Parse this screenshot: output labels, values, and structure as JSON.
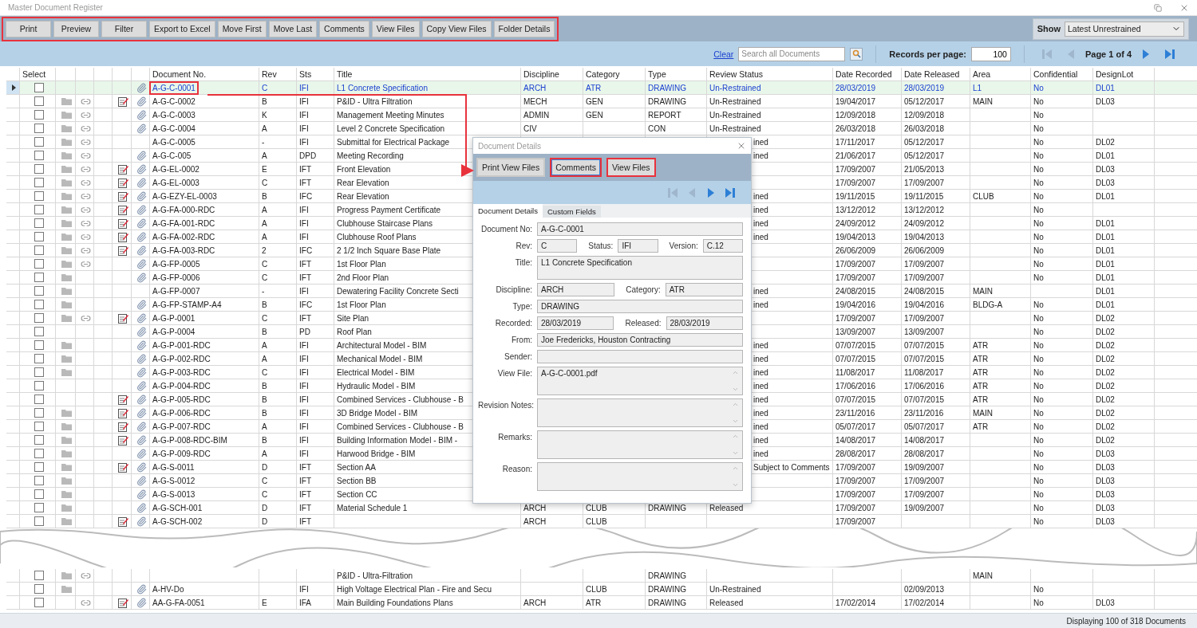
{
  "window": {
    "title": "Master Document Register"
  },
  "toolbar": {
    "highlighted": true,
    "buttons": [
      "Print",
      "Preview",
      "Filter",
      "Export to Excel",
      "Move First",
      "Move Last",
      "Comments",
      "View Files",
      "Copy View Files",
      "Folder Details"
    ],
    "show_label": "Show",
    "show_value": "Latest Unrestrained"
  },
  "search_bar": {
    "clear": "Clear",
    "placeholder": "Search all Documents",
    "records_label": "Records per page:",
    "records_value": "100",
    "page_label": "Page 1 of 4",
    "nav": [
      {
        "kind": "first",
        "disabled": true
      },
      {
        "kind": "prev",
        "disabled": true
      },
      {
        "kind": "next",
        "disabled": false
      },
      {
        "kind": "last",
        "disabled": false
      }
    ]
  },
  "table": {
    "columns": [
      "Select",
      "Document No.",
      "Rev",
      "Sts",
      "Title",
      "Discipline",
      "Category",
      "Type",
      "Review Status",
      "Date Recorded",
      "Date Released",
      "Area",
      "Confidential",
      "DesignLot"
    ],
    "rows": [
      {
        "selected": true,
        "highlighted": true,
        "checked": false,
        "folder": false,
        "link": false,
        "notes": false,
        "attach": true,
        "doc": "A-G-C-0001",
        "rev": "C",
        "sts": "IFI",
        "title": "L1 Concrete Specification",
        "discipline": "ARCH",
        "category": "ATR",
        "type": "DRAWING",
        "review": "Un-Restrained",
        "recorded": "28/03/2019",
        "released": "28/03/2019",
        "area": "L1",
        "confidential": "No",
        "lot": "DL01"
      },
      {
        "selected": false,
        "highlighted": false,
        "checked": false,
        "folder": true,
        "link": true,
        "notes": true,
        "attach": true,
        "doc": "A-G-C-0002",
        "rev": "B",
        "sts": "IFI",
        "title": "P&ID - Ultra Filtration",
        "discipline": "MECH",
        "category": "GEN",
        "type": "DRAWING",
        "review": "Un-Restrained",
        "recorded": "19/04/2017",
        "released": "05/12/2017",
        "area": "MAIN",
        "confidential": "No",
        "lot": "DL03"
      },
      {
        "selected": false,
        "highlighted": false,
        "checked": false,
        "folder": true,
        "link": true,
        "notes": false,
        "attach": true,
        "doc": "A-G-C-0003",
        "rev": "K",
        "sts": "IFI",
        "title": "Management Meeting Minutes",
        "discipline": "ADMIN",
        "category": "GEN",
        "type": "REPORT",
        "review": "Un-Restrained",
        "recorded": "12/09/2018",
        "released": "12/09/2018",
        "confidential": "No"
      },
      {
        "selected": false,
        "highlighted": false,
        "checked": false,
        "folder": true,
        "link": true,
        "notes": false,
        "attach": true,
        "doc": "A-G-C-0004",
        "rev": "A",
        "sts": "IFI",
        "title": "Level 2 Concrete Specification",
        "discipline": "CIV",
        "type": "CON",
        "review": "Un-Restrained",
        "recorded": "26/03/2018",
        "released": "26/03/2018",
        "confidential": "No"
      },
      {
        "selected": false,
        "highlighted": false,
        "checked": false,
        "folder": true,
        "link": true,
        "notes": false,
        "attach": false,
        "doc": "A-G-C-0005",
        "rev": "-",
        "sts": "IFI",
        "title": "Submittal for Electrical Package",
        "review": "ined",
        "recorded": "17/11/2017",
        "released": "05/12/2017",
        "confidential": "No",
        "lot": "DL02"
      },
      {
        "selected": false,
        "highlighted": false,
        "checked": false,
        "folder": true,
        "link": true,
        "notes": false,
        "attach": true,
        "doc": "A-G-C-005",
        "rev": "A",
        "sts": "DPD",
        "title": "Meeting Recording",
        "review": "ined",
        "recorded": "21/06/2017",
        "released": "05/12/2017",
        "confidential": "No",
        "lot": "DL01"
      },
      {
        "selected": false,
        "highlighted": false,
        "checked": false,
        "folder": true,
        "link": true,
        "notes": true,
        "attach": true,
        "doc": "A-G-EL-0002",
        "rev": "E",
        "sts": "IFT",
        "title": "Front Elevation",
        "recorded": "17/09/2007",
        "released": "21/05/2013",
        "confidential": "No",
        "lot": "DL03"
      },
      {
        "selected": false,
        "highlighted": false,
        "checked": false,
        "folder": true,
        "link": true,
        "notes": true,
        "attach": true,
        "doc": "A-G-EL-0003",
        "rev": "C",
        "sts": "IFT",
        "title": "Rear Elevation",
        "recorded": "17/09/2007",
        "released": "17/09/2007",
        "confidential": "No",
        "lot": "DL03"
      },
      {
        "selected": false,
        "highlighted": false,
        "checked": false,
        "folder": true,
        "link": true,
        "notes": true,
        "attach": true,
        "doc": "A-G-EZY-EL-0003",
        "rev": "B",
        "sts": "IFC",
        "title": "Rear Elevation",
        "review": "ined",
        "recorded": "19/11/2015",
        "released": "19/11/2015",
        "area": "CLUB",
        "confidential": "No",
        "lot": "DL01"
      },
      {
        "selected": false,
        "highlighted": false,
        "checked": false,
        "folder": true,
        "link": true,
        "notes": true,
        "attach": true,
        "doc": "A-G-FA-000-RDC",
        "rev": "A",
        "sts": "IFI",
        "title": "Progress Payment Certificate",
        "review": "ined",
        "recorded": "13/12/2012",
        "released": "13/12/2012",
        "confidential": "No"
      },
      {
        "selected": false,
        "highlighted": false,
        "checked": false,
        "folder": true,
        "link": true,
        "notes": true,
        "attach": true,
        "doc": "A-G-FA-001-RDC",
        "rev": "A",
        "sts": "IFI",
        "title": "Clubhouse Staircase Plans",
        "review": "ined",
        "recorded": "24/09/2012",
        "released": "24/09/2012",
        "confidential": "No",
        "lot": "DL01"
      },
      {
        "selected": false,
        "highlighted": false,
        "checked": false,
        "folder": true,
        "link": true,
        "notes": true,
        "attach": true,
        "doc": "A-G-FA-002-RDC",
        "rev": "A",
        "sts": "IFI",
        "title": "Clubhouse Roof Plans",
        "review": "ined",
        "recorded": "19/04/2013",
        "released": "19/04/2013",
        "confidential": "No",
        "lot": "DL01"
      },
      {
        "selected": false,
        "highlighted": false,
        "checked": false,
        "folder": true,
        "link": true,
        "notes": true,
        "attach": true,
        "doc": "A-G-FA-003-RDC",
        "rev": "2",
        "sts": "IFC",
        "title": "2 1/2 Inch Square Base Plate",
        "recorded": "26/06/2009",
        "released": "26/06/2009",
        "confidential": "No",
        "lot": "DL01"
      },
      {
        "selected": false,
        "highlighted": false,
        "checked": false,
        "folder": true,
        "link": true,
        "notes": false,
        "attach": true,
        "doc": "A-G-FP-0005",
        "rev": "C",
        "sts": "IFT",
        "title": "1st Floor Plan",
        "recorded": "17/09/2007",
        "released": "17/09/2007",
        "confidential": "No",
        "lot": "DL01"
      },
      {
        "selected": false,
        "highlighted": false,
        "checked": false,
        "folder": true,
        "link": false,
        "notes": false,
        "attach": true,
        "doc": "A-G-FP-0006",
        "rev": "C",
        "sts": "IFT",
        "title": "2nd Floor Plan",
        "recorded": "17/09/2007",
        "released": "17/09/2007",
        "confidential": "No",
        "lot": "DL01"
      },
      {
        "selected": false,
        "highlighted": false,
        "checked": false,
        "folder": true,
        "link": false,
        "notes": false,
        "attach": false,
        "doc": "A-G-FP-0007",
        "rev": "-",
        "sts": "IFI",
        "title": "Dewatering Facility Concrete Secti",
        "review": "ined",
        "recorded": "24/08/2015",
        "released": "24/08/2015",
        "area": "MAIN",
        "lot": "DL01"
      },
      {
        "selected": false,
        "highlighted": false,
        "checked": false,
        "folder": true,
        "link": false,
        "notes": false,
        "attach": true,
        "doc": "A-G-FP-STAMP-A4",
        "rev": "B",
        "sts": "IFC",
        "title": "1st Floor Plan",
        "review": "ined",
        "recorded": "19/04/2016",
        "released": "19/04/2016",
        "area": "BLDG-A",
        "confidential": "No",
        "lot": "DL01"
      },
      {
        "selected": false,
        "highlighted": false,
        "checked": false,
        "folder": true,
        "link": true,
        "notes": true,
        "attach": true,
        "doc": "A-G-P-0001",
        "rev": "C",
        "sts": "IFT",
        "title": "Site Plan",
        "recorded": "17/09/2007",
        "released": "17/09/2007",
        "confidential": "No",
        "lot": "DL02"
      },
      {
        "selected": false,
        "highlighted": false,
        "checked": false,
        "folder": false,
        "link": false,
        "notes": false,
        "attach": true,
        "doc": "A-G-P-0004",
        "rev": "B",
        "sts": "PD",
        "title": "Roof Plan",
        "recorded": "13/09/2007",
        "released": "13/09/2007",
        "confidential": "No",
        "lot": "DL02"
      },
      {
        "selected": false,
        "highlighted": false,
        "checked": false,
        "folder": true,
        "link": false,
        "notes": false,
        "attach": true,
        "doc": "A-G-P-001-RDC",
        "rev": "A",
        "sts": "IFI",
        "title": "Architectural Model - BIM",
        "review": "ined",
        "recorded": "07/07/2015",
        "released": "07/07/2015",
        "area": "ATR",
        "confidential": "No",
        "lot": "DL02"
      },
      {
        "selected": false,
        "highlighted": false,
        "checked": false,
        "folder": true,
        "link": false,
        "notes": false,
        "attach": true,
        "doc": "A-G-P-002-RDC",
        "rev": "A",
        "sts": "IFI",
        "title": "Mechanical Model - BIM",
        "review": "ined",
        "recorded": "07/07/2015",
        "released": "07/07/2015",
        "area": "ATR",
        "confidential": "No",
        "lot": "DL02"
      },
      {
        "selected": false,
        "highlighted": false,
        "checked": false,
        "folder": true,
        "link": false,
        "notes": false,
        "attach": true,
        "doc": "A-G-P-003-RDC",
        "rev": "C",
        "sts": "IFI",
        "title": "Electrical Model - BIM",
        "review": "ined",
        "recorded": "11/08/2017",
        "released": "11/08/2017",
        "area": "ATR",
        "confidential": "No",
        "lot": "DL02"
      },
      {
        "selected": false,
        "highlighted": false,
        "checked": false,
        "folder": false,
        "link": false,
        "notes": false,
        "attach": true,
        "doc": "A-G-P-004-RDC",
        "rev": "B",
        "sts": "IFI",
        "title": "Hydraulic Model - BIM",
        "review": "ined",
        "recorded": "17/06/2016",
        "released": "17/06/2016",
        "area": "ATR",
        "confidential": "No",
        "lot": "DL02"
      },
      {
        "selected": false,
        "highlighted": false,
        "checked": false,
        "folder": false,
        "link": false,
        "notes": true,
        "attach": true,
        "doc": "A-G-P-005-RDC",
        "rev": "B",
        "sts": "IFI",
        "title": "Combined Services - Clubhouse - B",
        "review": "ined",
        "recorded": "07/07/2015",
        "released": "07/07/2015",
        "area": "ATR",
        "confidential": "No",
        "lot": "DL02"
      },
      {
        "selected": false,
        "highlighted": false,
        "checked": false,
        "folder": true,
        "link": false,
        "notes": true,
        "attach": true,
        "doc": "A-G-P-006-RDC",
        "rev": "B",
        "sts": "IFI",
        "title": "3D Bridge Model - BIM",
        "review": "ined",
        "recorded": "23/11/2016",
        "released": "23/11/2016",
        "area": "MAIN",
        "confidential": "No",
        "lot": "DL02"
      },
      {
        "selected": false,
        "highlighted": false,
        "checked": false,
        "folder": true,
        "link": false,
        "notes": true,
        "attach": true,
        "doc": "A-G-P-007-RDC",
        "rev": "A",
        "sts": "IFI",
        "title": "Combined Services - Clubhouse - B",
        "review": "ined",
        "recorded": "05/07/2017",
        "released": "05/07/2017",
        "area": "ATR",
        "confidential": "No",
        "lot": "DL02"
      },
      {
        "selected": false,
        "highlighted": false,
        "checked": false,
        "folder": true,
        "link": false,
        "notes": true,
        "attach": true,
        "doc": "A-G-P-008-RDC-BIM",
        "rev": "B",
        "sts": "IFI",
        "title": "Building Information Model - BIM -",
        "review": "ined",
        "recorded": "14/08/2017",
        "released": "14/08/2017",
        "confidential": "No",
        "lot": "DL02"
      },
      {
        "selected": false,
        "highlighted": false,
        "checked": false,
        "folder": true,
        "link": false,
        "notes": false,
        "attach": true,
        "doc": "A-G-P-009-RDC",
        "rev": "A",
        "sts": "IFI",
        "title": "Harwood Bridge - BIM",
        "review": "ined",
        "recorded": "28/08/2017",
        "released": "28/08/2017",
        "confidential": "No",
        "lot": "DL03"
      },
      {
        "selected": false,
        "highlighted": false,
        "checked": false,
        "folder": true,
        "link": false,
        "notes": true,
        "attach": true,
        "doc": "A-G-S-0011",
        "rev": "D",
        "sts": "IFT",
        "title": "Section AA",
        "review": "Subject to Comments",
        "recorded": "17/09/2007",
        "released": "19/09/2007",
        "confidential": "No",
        "lot": "DL03"
      },
      {
        "selected": false,
        "highlighted": false,
        "checked": false,
        "folder": true,
        "link": false,
        "notes": false,
        "attach": true,
        "doc": "A-G-S-0012",
        "rev": "C",
        "sts": "IFT",
        "title": "Section BB",
        "recorded": "17/09/2007",
        "released": "17/09/2007",
        "confidential": "No",
        "lot": "DL03"
      },
      {
        "selected": false,
        "highlighted": false,
        "checked": false,
        "folder": true,
        "link": false,
        "notes": false,
        "attach": true,
        "doc": "A-G-S-0013",
        "rev": "C",
        "sts": "IFT",
        "title": "Section CC",
        "recorded": "17/09/2007",
        "released": "17/09/2007",
        "confidential": "No",
        "lot": "DL03"
      },
      {
        "selected": false,
        "highlighted": false,
        "checked": false,
        "folder": true,
        "link": false,
        "notes": false,
        "attach": true,
        "doc": "A-G-SCH-001",
        "rev": "D",
        "sts": "IFT",
        "title": "Material Schedule 1",
        "discipline": "ARCH",
        "category": "CLUB",
        "type": "DRAWING",
        "review": "Released",
        "recorded": "17/09/2007",
        "released": "19/09/2007",
        "confidential": "No",
        "lot": "DL03"
      },
      {
        "selected": false,
        "highlighted": false,
        "checked": false,
        "folder": true,
        "link": false,
        "notes": true,
        "attach": true,
        "doc": "A-G-SCH-002",
        "rev": "D",
        "sts": "IFT",
        "discipline": "ARCH",
        "category": "CLUB",
        "recorded": "17/09/2007",
        "confidential": "No",
        "lot": "DL03"
      }
    ],
    "rows_after_break": [
      {
        "selected": false,
        "checked": false,
        "folder": true,
        "link": true,
        "notes": false,
        "attach": false,
        "title": "P&ID - Ultra-Filtration",
        "type": "DRAWING",
        "area": "MAIN"
      },
      {
        "selected": false,
        "checked": false,
        "folder": true,
        "link": false,
        "notes": false,
        "attach": true,
        "doc": "A-HV-Do",
        "sts": "IFI",
        "title": "High Voltage Electrical Plan - Fire and Secu",
        "category": "CLUB",
        "type": "DRAWING",
        "review": "Un-Restrained",
        "released": "02/09/2013",
        "confidential": "No"
      },
      {
        "selected": false,
        "checked": false,
        "folder": false,
        "link": true,
        "notes": true,
        "attach": true,
        "doc": "AA-G-FA-0051",
        "rev": "E",
        "sts": "IFA",
        "title": "Main Building Foundations Plans",
        "discipline": "ARCH",
        "category": "ATR",
        "type": "DRAWING",
        "review": "Released",
        "recorded": "17/02/2014",
        "released": "17/02/2014",
        "confidential": "No",
        "lot": "DL03"
      }
    ]
  },
  "dialog": {
    "title": "Document Details",
    "buttons": [
      {
        "label": "Print View Files",
        "highlighted": false,
        "focused": false
      },
      {
        "label": "Comments",
        "highlighted": true,
        "focused": true
      },
      {
        "label": "View Files",
        "highlighted": true,
        "focused": false
      }
    ],
    "nav": [
      {
        "kind": "first",
        "disabled": true
      },
      {
        "kind": "prev",
        "disabled": true
      },
      {
        "kind": "next",
        "disabled": false
      },
      {
        "kind": "last",
        "disabled": false
      }
    ],
    "tabs": [
      {
        "label": "Document Details",
        "selected": true
      },
      {
        "label": "Custom Fields",
        "selected": false
      }
    ],
    "rows": [
      {
        "kind": "line",
        "fields": [
          {
            "label": "Document No:",
            "value": "A-G-C-0001"
          }
        ]
      },
      {
        "kind": "line",
        "fields": [
          {
            "label": "Rev:",
            "value": "C"
          },
          {
            "label": "Status:",
            "value": "IFI"
          },
          {
            "label": "Version:",
            "value": "C.12"
          }
        ]
      },
      {
        "kind": "box",
        "fields": [
          {
            "label": "Title:",
            "value": "L1 Concrete Specification"
          }
        ]
      },
      {
        "kind": "line",
        "fields": [
          {
            "label": "Discipline:",
            "value": "ARCH"
          },
          {
            "label": "Category:",
            "value": "ATR"
          }
        ]
      },
      {
        "kind": "line",
        "fields": [
          {
            "label": "Type:",
            "value": "DRAWING"
          }
        ]
      },
      {
        "kind": "line",
        "fields": [
          {
            "label": "Recorded:",
            "value": "28/03/2019"
          },
          {
            "label": "Released:",
            "value": "28/03/2019"
          }
        ]
      },
      {
        "kind": "line",
        "fields": [
          {
            "label": "From:",
            "value": "Joe Fredericks, Houston Contracting"
          }
        ]
      },
      {
        "kind": "line",
        "fields": [
          {
            "label": "Sender:"
          }
        ]
      },
      {
        "kind": "scroll",
        "fields": [
          {
            "label": "View File:",
            "value": "A-G-C-0001.pdf"
          }
        ]
      },
      {
        "kind": "scroll",
        "fields": [
          {
            "label": "Revision Notes:"
          }
        ]
      },
      {
        "kind": "scroll",
        "fields": [
          {
            "label": "Remarks:"
          }
        ]
      },
      {
        "kind": "scroll",
        "fields": [
          {
            "label": "Reason:"
          }
        ]
      }
    ]
  },
  "status_bar": "Displaying 100 of 318 Documents"
}
